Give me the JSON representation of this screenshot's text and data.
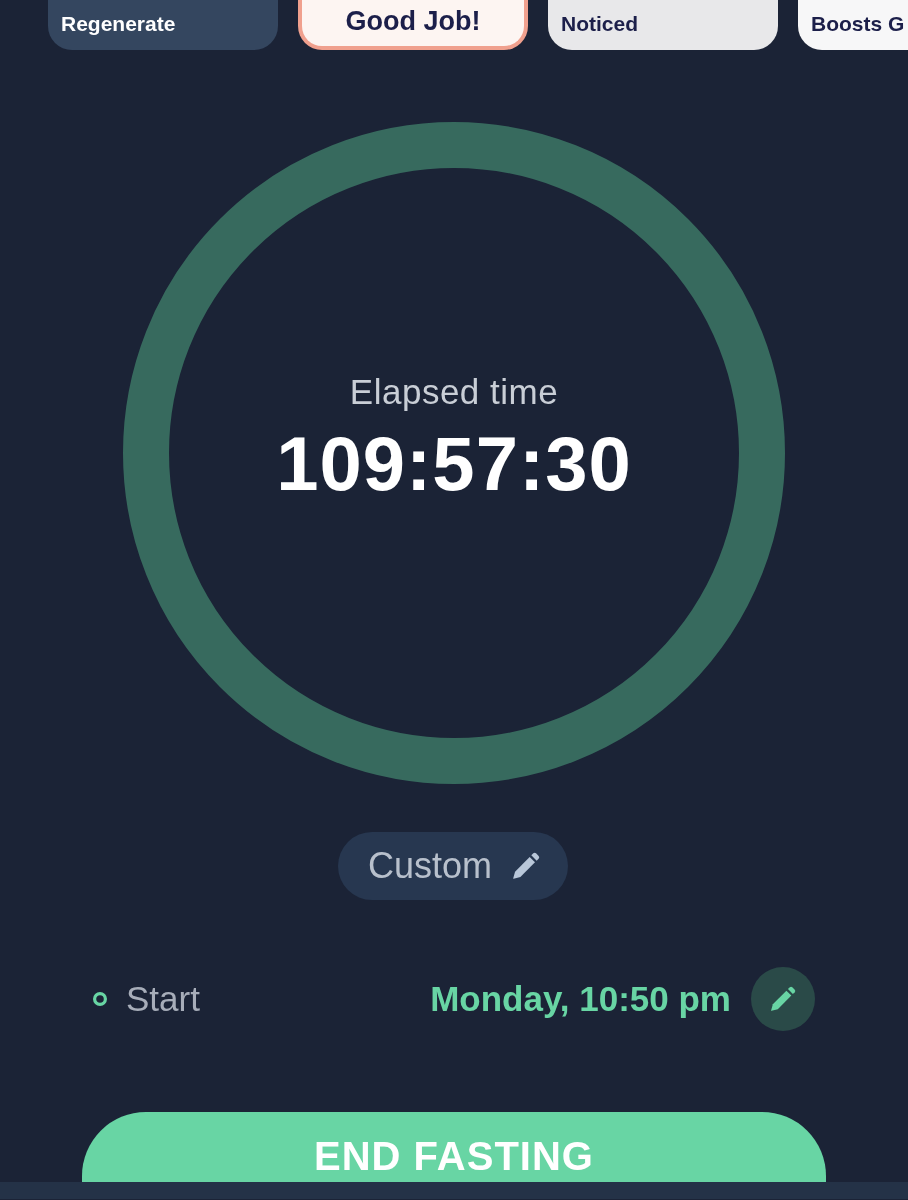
{
  "story_cards": [
    {
      "title": "Regenerate",
      "color": "#34465f",
      "selected": false
    },
    {
      "title": "Good Job!",
      "color": "#fdf5f2",
      "selected": true
    },
    {
      "title": "Noticed",
      "color": "#e8e8ea",
      "selected": false
    },
    {
      "title": "Boosts G",
      "color": "#f7f7f8",
      "selected": false
    }
  ],
  "timer": {
    "label": "Elapsed time",
    "value": "109:57:30",
    "level": 1
  },
  "fast_type": {
    "label": "Custom"
  },
  "start": {
    "label": "Start",
    "value": "Monday, 10:50 pm"
  },
  "end_button": {
    "label": "END FASTING"
  }
}
